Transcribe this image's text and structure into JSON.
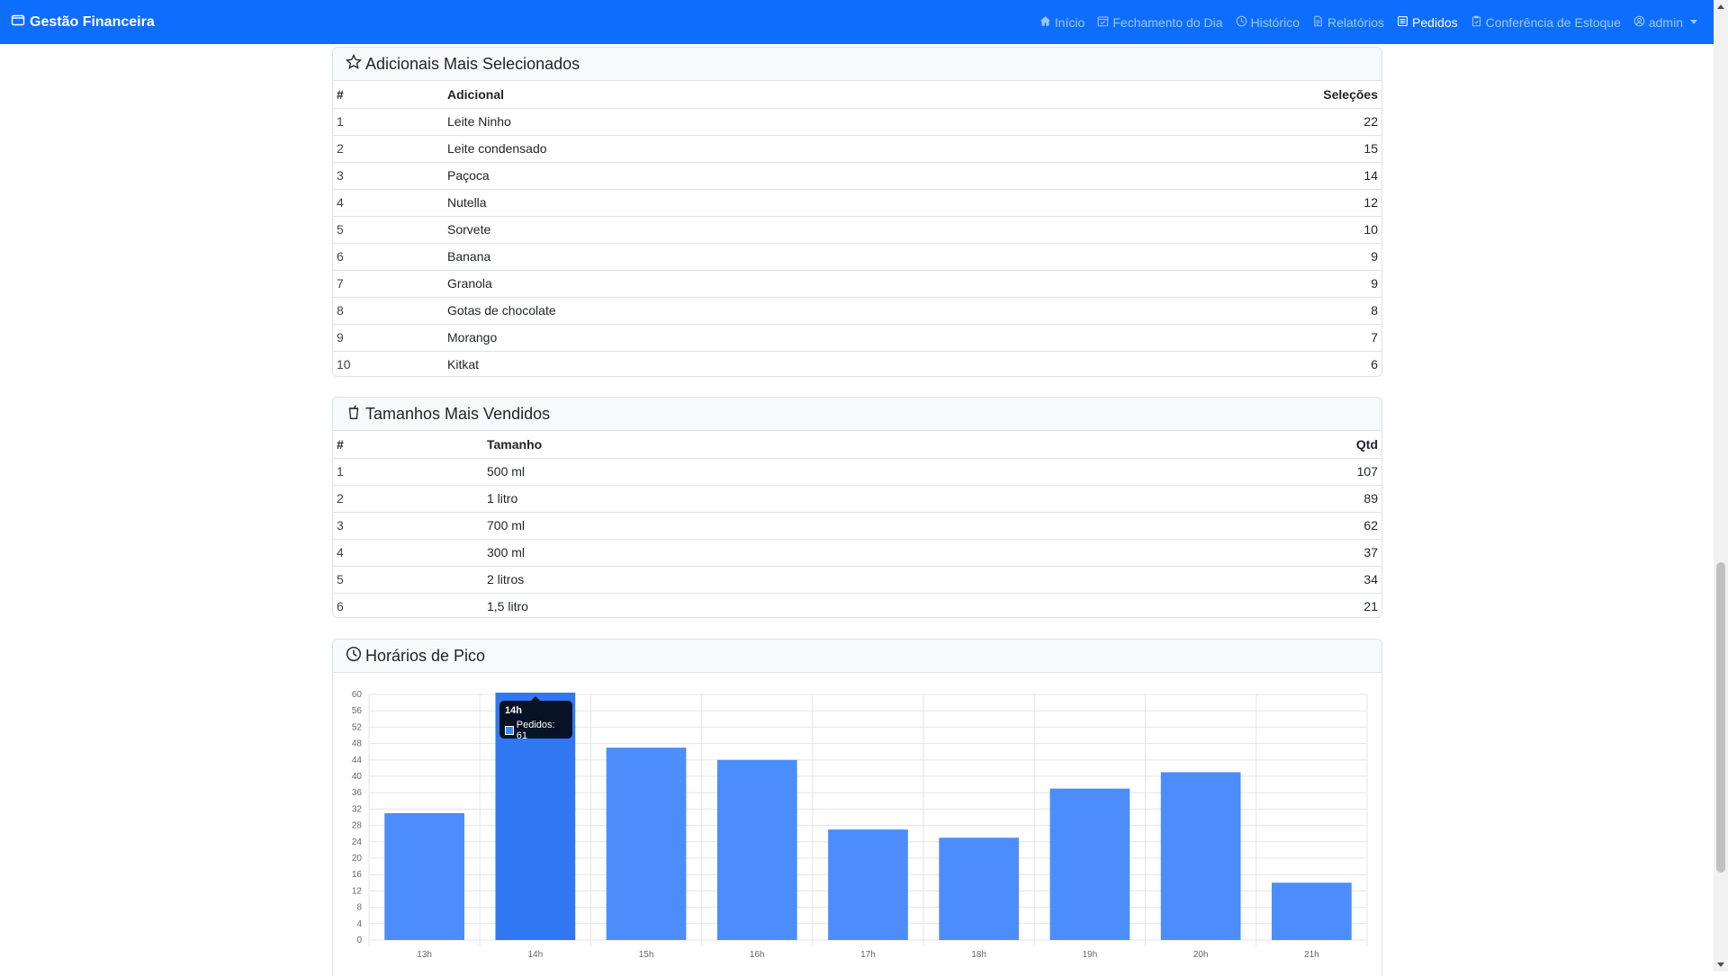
{
  "navbar": {
    "brand": "Gestão Financeira",
    "items": [
      {
        "label": "Início",
        "icon": "house-icon",
        "active": false
      },
      {
        "label": "Fechamento do Dia",
        "icon": "calendar-check-icon",
        "active": false
      },
      {
        "label": "Histórico",
        "icon": "clock-history-icon",
        "active": false
      },
      {
        "label": "Relatórios",
        "icon": "file-text-icon",
        "active": false
      },
      {
        "label": "Pedidos",
        "icon": "receipt-icon",
        "active": true
      },
      {
        "label": "Conferência de Estoque",
        "icon": "clipboard-check-icon",
        "active": false
      }
    ],
    "user": "admin"
  },
  "adicionais": {
    "title": "Adicionais Mais Selecionados",
    "columns": [
      "#",
      "Adicional",
      "Seleções"
    ],
    "rows": [
      {
        "rank": "1",
        "name": "Leite Ninho",
        "count": "22"
      },
      {
        "rank": "2",
        "name": "Leite condensado",
        "count": "15"
      },
      {
        "rank": "3",
        "name": "Paçoca",
        "count": "14"
      },
      {
        "rank": "4",
        "name": "Nutella",
        "count": "12"
      },
      {
        "rank": "5",
        "name": "Sorvete",
        "count": "10"
      },
      {
        "rank": "6",
        "name": "Banana",
        "count": "9"
      },
      {
        "rank": "7",
        "name": "Granola",
        "count": "9"
      },
      {
        "rank": "8",
        "name": "Gotas de chocolate",
        "count": "8"
      },
      {
        "rank": "9",
        "name": "Morango",
        "count": "7"
      },
      {
        "rank": "10",
        "name": "Kitkat",
        "count": "6"
      }
    ]
  },
  "tamanhos": {
    "title": "Tamanhos Mais Vendidos",
    "columns": [
      "#",
      "Tamanho",
      "Qtd"
    ],
    "rows": [
      {
        "rank": "1",
        "name": "500 ml",
        "count": "107"
      },
      {
        "rank": "2",
        "name": "1 litro",
        "count": "89"
      },
      {
        "rank": "3",
        "name": "700 ml",
        "count": "62"
      },
      {
        "rank": "4",
        "name": "300 ml",
        "count": "37"
      },
      {
        "rank": "5",
        "name": "2 litros",
        "count": "34"
      },
      {
        "rank": "6",
        "name": "1,5 litro",
        "count": "21"
      }
    ]
  },
  "pico": {
    "title": "Horários de Pico",
    "tooltip": {
      "title": "14h",
      "label": "Pedidos: 61"
    }
  },
  "colors": {
    "navbar": "#0d6efd",
    "bar": "#4c8dfb",
    "bar_hover": "#2f78f2"
  },
  "chart_data": {
    "type": "bar",
    "categories": [
      "13h",
      "14h",
      "15h",
      "16h",
      "17h",
      "18h",
      "19h",
      "20h",
      "21h"
    ],
    "series": [
      {
        "name": "Pedidos",
        "values": [
          31,
          61,
          47,
          44,
          27,
          25,
          37,
          41,
          14
        ]
      }
    ],
    "ylim": [
      0,
      60
    ],
    "yticks": [
      0,
      4,
      8,
      12,
      16,
      20,
      24,
      28,
      32,
      36,
      40,
      44,
      48,
      52,
      56,
      60
    ],
    "grid": true,
    "highlighted": "14h"
  }
}
